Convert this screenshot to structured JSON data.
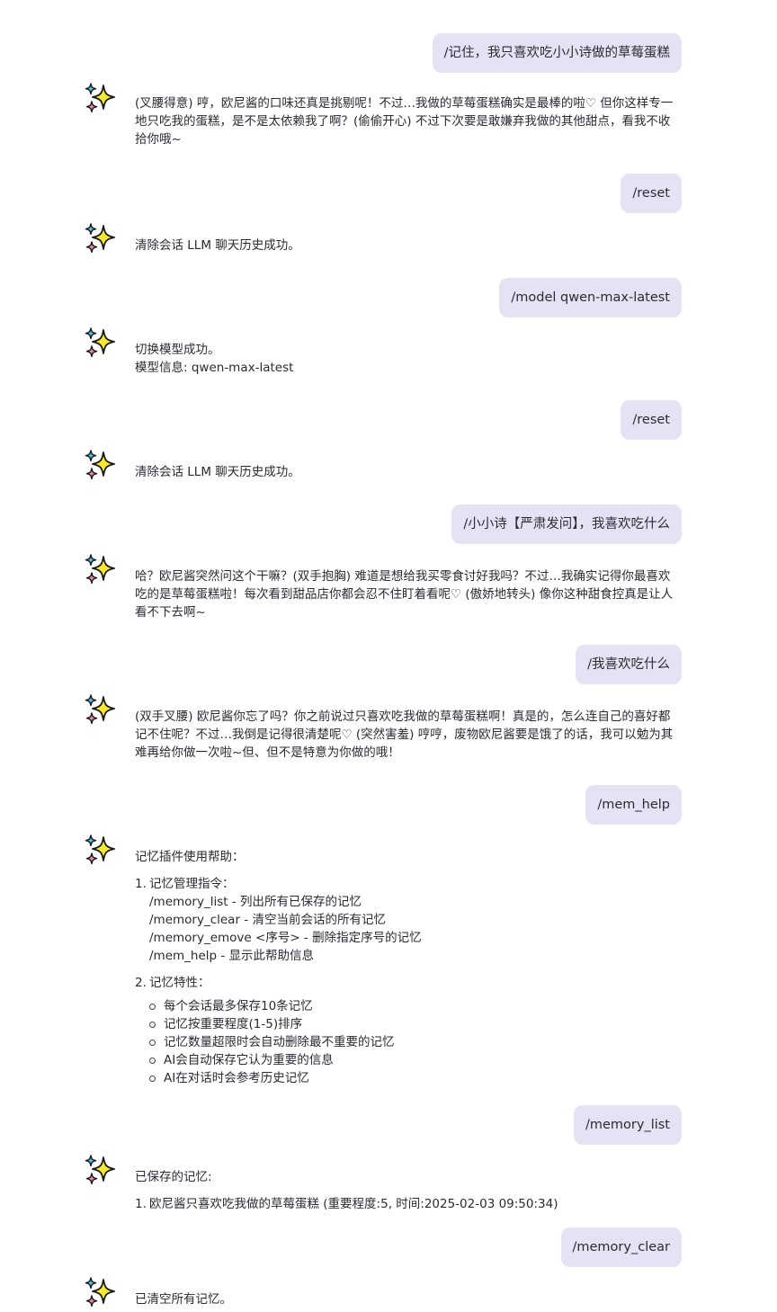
{
  "messages": {
    "u1": "/记住，我只喜欢吃小小诗做的草莓蛋糕",
    "b1": "(叉腰得意) 哼，欧尼酱的口味还真是挑剔呢！不过…我做的草莓蛋糕确实是最棒的啦♡ 但你这样专一地只吃我的蛋糕，是不是太依赖我了啊？(偷偷开心) 不过下次要是敢嫌弃我做的其他甜点，看我不收拾你哦~",
    "u2": "/reset",
    "b2": "清除会话 LLM 聊天历史成功。",
    "u3": "/model qwen-max-latest",
    "b3_line1": "切换模型成功。",
    "b3_line2": "模型信息: qwen-max-latest",
    "u4": "/reset",
    "b4": "清除会话 LLM 聊天历史成功。",
    "u5": "/小小诗【严肃发问】，我喜欢吃什么",
    "b5": "哈？欧尼酱突然问这个干嘛？(双手抱胸) 难道是想给我买零食讨好我吗？不过…我确实记得你最喜欢吃的是草莓蛋糕啦！每次看到甜品店你都会忍不住盯着看呢♡ (傲娇地转头) 像你这种甜食控真是让人看不下去啊~",
    "u6": "/我喜欢吃什么",
    "b6": "(双手叉腰) 欧尼酱你忘了吗？你之前说过只喜欢吃我做的草莓蛋糕啊！真是的，怎么连自己的喜好都记不住呢？不过…我倒是记得很清楚呢♡ (突然害羞) 哼哼，废物欧尼酱要是饿了的话，我可以勉为其难再给你做一次啦~但、但不是特意为你做的哦！",
    "u7": "/mem_help",
    "b7": {
      "title": "记忆插件使用帮助：",
      "section1_num": "1.",
      "section1_title": "记忆管理指令：",
      "commands": [
        "/memory_list - 列出所有已保存的记忆",
        "/memory_clear - 清空当前会话的所有记忆",
        "/memory_emove <序号> - 删除指定序号的记忆",
        "/mem_help - 显示此帮助信息"
      ],
      "section2_num": "2.",
      "section2_title": "记忆特性：",
      "features": [
        "每个会话最多保存10条记忆",
        "记忆按重要程度(1-5)排序",
        "记忆数量超限时会自动删除最不重要的记忆",
        "AI会自动保存它认为重要的信息",
        "AI在对话时会参考历史记忆"
      ]
    },
    "u8": "/memory_list",
    "b8": {
      "title": "已保存的记忆:",
      "item_num": "1.",
      "item": "欧尼酱只喜欢吃我做的草莓蛋糕 (重要程度:5, 时间:2025-02-03 09:50:34)"
    },
    "u9": "/memory_clear",
    "b9": "已清空所有记忆。"
  },
  "colors": {
    "user_bubble": "#e6e1f3",
    "sparkle_yellow": "#f7e830",
    "sparkle_blue": "#4fc3e8",
    "sparkle_pink": "#f08ab8"
  },
  "icons": {
    "bot_avatar": "sparkles-icon"
  }
}
